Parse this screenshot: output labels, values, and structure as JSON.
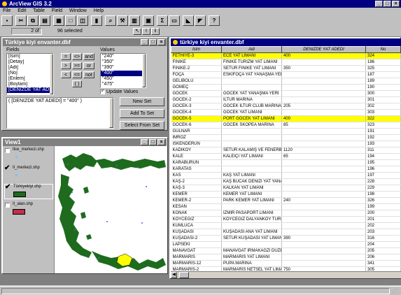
{
  "app": {
    "title": "ArcView GIS 3.2"
  },
  "menu": [
    "File",
    "Edit",
    "Table",
    "Field",
    "Window",
    "Help"
  ],
  "status": {
    "selected_count": "2",
    "of": "of",
    "total_text": "96 selected"
  },
  "query_window": {
    "title": "Türkiye kiyi envanter.dbf",
    "fields_label": "Fields",
    "values_label": "Values",
    "fields": [
      "[Isim]",
      "[Detay]",
      "[Adi]",
      "[No]",
      "[Enlem]",
      "[Boylam]",
      "[DENIZDE YAT AD"
    ],
    "values": [
      "\"240\"",
      "\"350\"",
      "\"390\"",
      "\"400\"",
      "\"450\"",
      "\"475\""
    ],
    "operators": [
      "=",
      "<>",
      "and",
      ">",
      ">=",
      "or",
      "<",
      "<=",
      "not",
      "( )"
    ],
    "update_values": "Update Values",
    "expression": "( [DENIZDE YAT ADEDI] = \"400\" )",
    "new_set": "New Set",
    "add_to_set": "Add To Set",
    "select_from_set": "Select From Set"
  },
  "view_window": {
    "title": "View1",
    "layers": [
      {
        "name": "Ilce_merkezi.shp",
        "checked": false
      },
      {
        "name": "Il_merkezi.shp",
        "checked": true
      },
      {
        "name": "Türkiyekiyi.shp",
        "checked": true
      },
      {
        "name": "Il_alan.shp",
        "checked": false
      }
    ]
  },
  "table_window": {
    "title": "türkiye kiyi envanter.dbf",
    "columns": [
      "Isim",
      "Adi",
      "DENIZDE YAT ADEDI",
      "No",
      ""
    ],
    "rows": [
      [
        "FETHIYE-3",
        "ECE YAT LIMANI",
        "400",
        "324",
        "3",
        true
      ],
      [
        "FINIKE",
        "FINIKE TURIZM YAT LIMANI",
        "",
        "186",
        "",
        false
      ],
      [
        "FINIKE-2",
        "SETUR FINIKE YAT LIMANI",
        "350",
        "325",
        "3",
        false
      ],
      [
        "FOÇA",
        "ESKIFOÇA YAT YANAŞMA YERI",
        "",
        "187",
        "",
        false
      ],
      [
        "GELIBOLU",
        "",
        "",
        "189",
        "",
        false
      ],
      [
        "GÖMEÇ",
        "",
        "",
        "190",
        "",
        false
      ],
      [
        "GÖCEK",
        "GÖCEK YAT YANAŞMA YERI",
        "",
        "300",
        "",
        false
      ],
      [
        "GÖCEK-2",
        "İLTUR MARINA",
        "",
        "301",
        "",
        false
      ],
      [
        "GÖCEK-3",
        "GÖCEK İLTUR CLUB MARINA",
        "205",
        "302",
        "3",
        false
      ],
      [
        "GÖCEK-4",
        "GÖCEK YAT LIMANI",
        "",
        "303",
        "",
        false
      ],
      [
        "GÖCEK-5",
        "PORT GÖCEK YAT LIMANI",
        "400",
        "322",
        "3",
        true
      ],
      [
        "GÖCEK-6",
        "GÖCEK SKOPEA MARINA",
        "85",
        "323",
        "3",
        false
      ],
      [
        "GULNAR",
        "",
        "",
        "191",
        "",
        false
      ],
      [
        "IMROZ",
        "",
        "",
        "192",
        "",
        false
      ],
      [
        "ISKENDERUN",
        "",
        "",
        "193",
        "",
        false
      ],
      [
        "KADIKÖY",
        "SETUR KALAMIŞ VE FENERBAH",
        "1120",
        "311",
        "",
        false
      ],
      [
        "KALE",
        "KALEIÇI YAT LIMANI",
        "65",
        "194",
        "3",
        false
      ],
      [
        "KARABURUN",
        "",
        "",
        "195",
        "",
        false
      ],
      [
        "KARATAS",
        "",
        "",
        "196",
        "",
        false
      ],
      [
        "KAS",
        "KAŞ YAT LIMANI",
        "",
        "197",
        "",
        false
      ],
      [
        "KAŞ-2",
        "KAŞ BUCAK DENIZI YAT YANAŞI",
        "",
        "228",
        "",
        false
      ],
      [
        "KAŞ-3",
        "KALKAN YAT LIMANI",
        "",
        "229",
        "",
        false
      ],
      [
        "KEMER",
        "KEMER YAT LIMANI",
        "",
        "198",
        "",
        false
      ],
      [
        "KEMER-2",
        "PARK KEMER YAT LIMANI",
        "240",
        "326",
        "3",
        false
      ],
      [
        "KESAN",
        "",
        "",
        "199",
        "",
        false
      ],
      [
        "KONAK",
        "İZMIR PASAPORT LIMANI",
        "",
        "200",
        "",
        false
      ],
      [
        "KÖYCEĞIZ",
        "KÖYCEĞIZ DALYANKÖY TURİZM",
        "",
        "201",
        "",
        false
      ],
      [
        "KUMLUCA",
        "",
        "",
        "202",
        "",
        false
      ],
      [
        "KUŞADASI",
        "KUŞADASI ANA YAT LIMANI",
        "",
        "203",
        "",
        false
      ],
      [
        "KUŞADASI-2",
        "SETUR KUŞADASI YAT LIMANI",
        "390",
        "316",
        "3",
        false
      ],
      [
        "LAPSEKI",
        "",
        "",
        "204",
        "",
        false
      ],
      [
        "MANAVGAT",
        "MANAVGAT IRMAKAĞZI DÜZEN",
        "",
        "205",
        "",
        false
      ],
      [
        "MARMARIS",
        "MARMARIS YAT LIMANI",
        "",
        "206",
        "",
        false
      ],
      [
        "MARMARIS-12",
        "PUPA MARINA",
        "",
        "341",
        "",
        false
      ],
      [
        "MARMARIS-2",
        "MARMARIS NETSEL YAT LIMAN",
        "750",
        "305",
        "3",
        false
      ],
      [
        "MARMARIS-3",
        "MARMARIN YAT LIMANI",
        "",
        "306",
        "",
        false
      ]
    ]
  },
  "colors": {
    "titlebar": "#000080",
    "highlight": "#ffff00",
    "land": "#1e6b1e",
    "selection": "#ffff00",
    "sea": "#ffffff"
  },
  "icons": [
    "save-icon",
    "cut-icon",
    "copy-icon",
    "paste-icon",
    "select-all-icon",
    "select-none-icon",
    "promote-icon",
    "chart-icon",
    "find-icon",
    "query-icon",
    "calculate-icon",
    "summarize-icon",
    "join-icon",
    "help-icon",
    "pointer-icon",
    "edit-icon",
    "info-icon"
  ]
}
